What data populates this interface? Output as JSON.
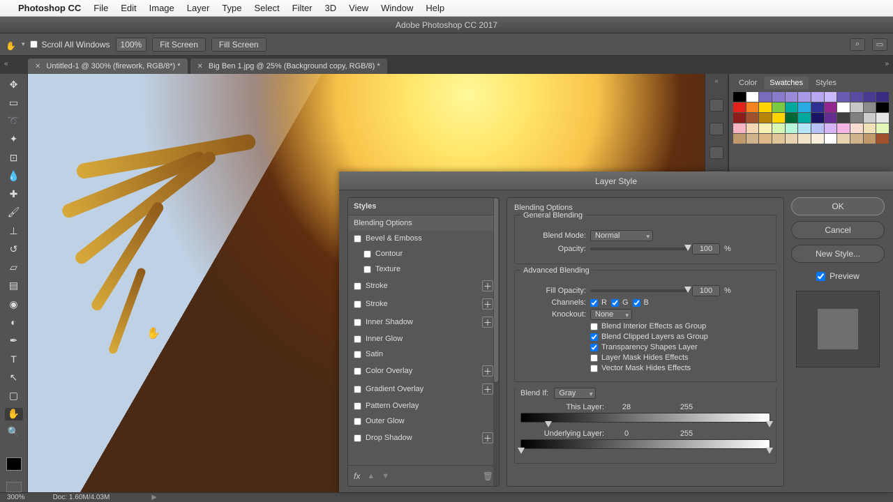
{
  "menu": {
    "app": "Photoshop CC",
    "items": [
      "File",
      "Edit",
      "Image",
      "Layer",
      "Type",
      "Select",
      "Filter",
      "3D",
      "View",
      "Window",
      "Help"
    ]
  },
  "window_title": "Adobe Photoshop CC 2017",
  "optbar": {
    "scroll_all": "Scroll All Windows",
    "zoom": "100%",
    "fit": "Fit Screen",
    "fill": "Fill Screen"
  },
  "tabs": [
    {
      "label": "Untitled-1 @ 300% (firework, RGB/8*) *",
      "active": true
    },
    {
      "label": "Big Ben 1.jpg @ 25% (Background copy, RGB/8) *",
      "active": false
    }
  ],
  "rpanel": {
    "tabs": [
      "Color",
      "Swatches",
      "Styles"
    ],
    "active": 1
  },
  "statusbar": {
    "zoom": "300%",
    "doc": "Doc: 1.60M/4.03M"
  },
  "dialog": {
    "title": "Layer Style",
    "styles_header": "Styles",
    "styles": [
      {
        "label": "Blending Options",
        "selected": true,
        "checkbox": false
      },
      {
        "label": "Bevel & Emboss",
        "checkbox": true
      },
      {
        "label": "Contour",
        "checkbox": true,
        "sub": true
      },
      {
        "label": "Texture",
        "checkbox": true,
        "sub": true
      },
      {
        "label": "Stroke",
        "checkbox": true,
        "plus": true
      },
      {
        "label": "Stroke",
        "checkbox": true,
        "plus": true
      },
      {
        "label": "Inner Shadow",
        "checkbox": true,
        "plus": true
      },
      {
        "label": "Inner Glow",
        "checkbox": true
      },
      {
        "label": "Satin",
        "checkbox": true
      },
      {
        "label": "Color Overlay",
        "checkbox": true,
        "plus": true
      },
      {
        "label": "Gradient Overlay",
        "checkbox": true,
        "plus": true
      },
      {
        "label": "Pattern Overlay",
        "checkbox": true
      },
      {
        "label": "Outer Glow",
        "checkbox": true
      },
      {
        "label": "Drop Shadow",
        "checkbox": true,
        "plus": true
      }
    ],
    "opts": {
      "heading": "Blending Options",
      "general_legend": "General Blending",
      "blend_mode_label": "Blend Mode:",
      "blend_mode": "Normal",
      "opacity_label": "Opacity:",
      "opacity": "100",
      "pct": "%",
      "advanced_legend": "Advanced Blending",
      "fill_opacity_label": "Fill Opacity:",
      "fill_opacity": "100",
      "channels_label": "Channels:",
      "ch_r": "R",
      "ch_g": "G",
      "ch_b": "B",
      "knockout_label": "Knockout:",
      "knockout": "None",
      "chk1": "Blend Interior Effects as Group",
      "chk2": "Blend Clipped Layers as Group",
      "chk3": "Transparency Shapes Layer",
      "chk4": "Layer Mask Hides Effects",
      "chk5": "Vector Mask Hides Effects",
      "blendif_label": "Blend If:",
      "blendif": "Gray",
      "this_layer_label": "This Layer:",
      "this_layer_lo": "28",
      "this_layer_hi": "255",
      "under_label": "Underlying Layer:",
      "under_lo": "0",
      "under_hi": "255"
    },
    "buttons": {
      "ok": "OK",
      "cancel": "Cancel",
      "newstyle": "New Style...",
      "preview": "Preview"
    },
    "footer": {
      "fx": "fx"
    }
  },
  "swatch_colors": [
    "#000000",
    "#ffffff",
    "#7a6bbf",
    "#8a7acc",
    "#9a8ad9",
    "#aa9ae6",
    "#baa9f2",
    "#cab9ff",
    "#6a5ab0",
    "#5a4aa0",
    "#4a3a90",
    "#3a2a80",
    "#e2231a",
    "#f58220",
    "#ffd400",
    "#7ac943",
    "#00a99d",
    "#29abe2",
    "#2e3192",
    "#93278f",
    "#ffffff",
    "#c7c7c7",
    "#8c8c8c",
    "#000000",
    "#8c1d18",
    "#a0522d",
    "#b8860b",
    "#ffd400",
    "#006837",
    "#00a99d",
    "#1b1464",
    "#662d91",
    "#404040",
    "#808080",
    "#cccccc",
    "#e6e6e6",
    "#f7b5c1",
    "#f7d6b5",
    "#f7f2b5",
    "#d6f7b5",
    "#b5f7d6",
    "#b5e6f7",
    "#b5c1f7",
    "#d6b5f7",
    "#f7b5e6",
    "#f7dccf",
    "#efe1b5",
    "#e0f7b5",
    "#c19a6b",
    "#d2b48c",
    "#deb887",
    "#e0c69a",
    "#e8d4b0",
    "#f0e2c6",
    "#f7eedb",
    "#ffffff",
    "#e8d4b0",
    "#d2b48c",
    "#c19a6b",
    "#a0522d"
  ]
}
